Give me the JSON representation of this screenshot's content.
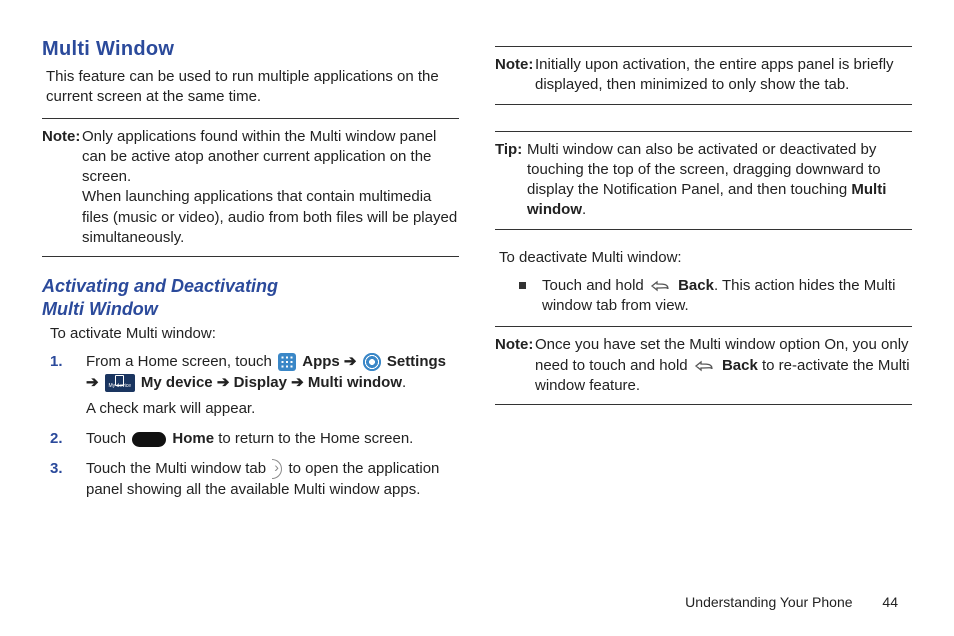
{
  "left": {
    "heading": "Multi Window",
    "intro": "This feature can be used to run multiple applications on the current screen at the same time.",
    "note1_label": "Note:",
    "note1_a": "Only applications found within the Multi window panel can be active atop another current application on the screen.",
    "note1_b": "When launching applications that contain multimedia files (music or video), audio from both files will be played simultaneously.",
    "subheading_a": "Activating and Deactivating",
    "subheading_b": "Multi Window",
    "activate_intro": "To activate Multi window:",
    "step1_a": "From a Home screen, touch ",
    "apps": "Apps",
    "arrow": "➔",
    "settings": "Settings",
    "mydevice": "My device",
    "display": "Display",
    "multiwindow": "Multi window",
    "period": ".",
    "step1_sub": "A check mark will appear.",
    "step2_a": "Touch ",
    "home": "Home",
    "step2_b": " to return to the Home screen.",
    "step3_a": "Touch the Multi window tab ",
    "step3_b": " to open the application panel showing all the available Multi window apps."
  },
  "right": {
    "note2_label": "Note:",
    "note2": "Initially upon activation, the entire apps panel is briefly displayed, then minimized to only show the tab.",
    "tip_label": "Tip:",
    "tip_a": "Multi window can also be activated or deactivated by touching the top of the screen, dragging downward to display the Notification Panel, and then touching ",
    "tip_bold": "Multi window",
    "deactivate_intro": "To deactivate Multi window:",
    "bullet_a": "Touch and hold ",
    "back": "Back",
    "bullet_b": ". This action hides the Multi window tab from view.",
    "note3_label": "Note:",
    "note3_a": "Once you have set the Multi window option On, you only need to touch and hold ",
    "note3_b": " to re-activate the Multi window feature."
  },
  "footer": {
    "section": "Understanding Your Phone",
    "page": "44"
  },
  "icons": {
    "mydevice_text": "My device"
  }
}
